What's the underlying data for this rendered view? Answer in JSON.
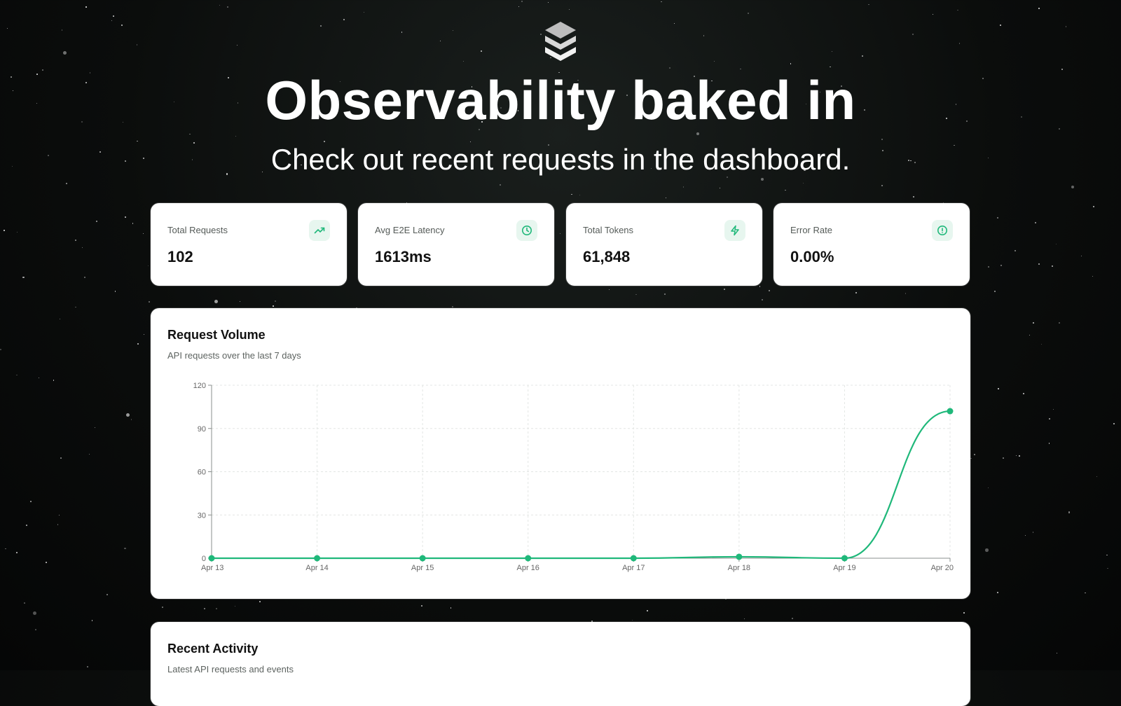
{
  "hero": {
    "title": "Observability baked in",
    "subtitle": "Check out recent requests in the dashboard."
  },
  "icons": {
    "logo": "stacked-layers-logo",
    "total_requests": "trending-up-icon",
    "latency": "clock-icon",
    "tokens": "lightning-bolt-icon",
    "error_rate": "info-circle-icon"
  },
  "colors": {
    "accent": "#1fb87a",
    "icon_bg": "#e7f6ef"
  },
  "stats": [
    {
      "label": "Total Requests",
      "value": "102"
    },
    {
      "label": "Avg E2E Latency",
      "value": "1613ms"
    },
    {
      "label": "Total Tokens",
      "value": "61,848"
    },
    {
      "label": "Error Rate",
      "value": "0.00%"
    }
  ],
  "request_volume": {
    "title": "Request Volume",
    "subtitle": "API requests over the last 7 days"
  },
  "chart_data": {
    "type": "line",
    "title": "Request Volume",
    "subtitle": "API requests over the last 7 days",
    "categories": [
      "Apr 13",
      "Apr 14",
      "Apr 15",
      "Apr 16",
      "Apr 17",
      "Apr 18",
      "Apr 19",
      "Apr 20"
    ],
    "series": [
      {
        "values": [
          0,
          0,
          0,
          0,
          0,
          1,
          0,
          102
        ]
      }
    ],
    "yticks": [
      0,
      30,
      60,
      90,
      120
    ],
    "ylim": [
      0,
      120
    ],
    "grid": true,
    "curve": "smooth",
    "color": "#1fb87a"
  },
  "recent_activity": {
    "title": "Recent Activity",
    "subtitle": "Latest API requests and events"
  }
}
